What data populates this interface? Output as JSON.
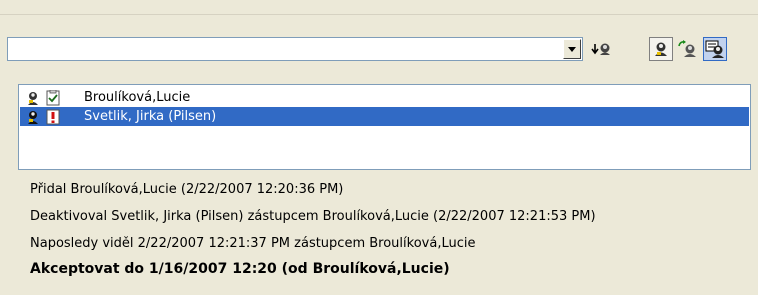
{
  "combo": {
    "value": ""
  },
  "list": {
    "items": [
      {
        "name": "Broulíková,Lucie",
        "status_icon": "checkbox-checked-icon",
        "selected": false
      },
      {
        "name": "Svetlik, Jirka (Pilsen)",
        "status_icon": "exclamation-icon",
        "selected": true
      }
    ]
  },
  "info": {
    "added": "Přidal Broulíková,Lucie (2/22/2007 12:20:36 PM)",
    "deactivated": "Deaktivoval Svetlik, Jirka (Pilsen) zástupcem Broulíková,Lucie (2/22/2007 12:21:53 PM)",
    "last_seen": "Naposledy viděl 2/22/2007 12:21:37 PM zástupcem Broulíková,Lucie",
    "accept": "Akceptovat do 1/16/2007 12:20 (od Broulíková,Lucie)"
  },
  "colors": {
    "selection": "#316ac5",
    "background": "#ece9d8"
  }
}
